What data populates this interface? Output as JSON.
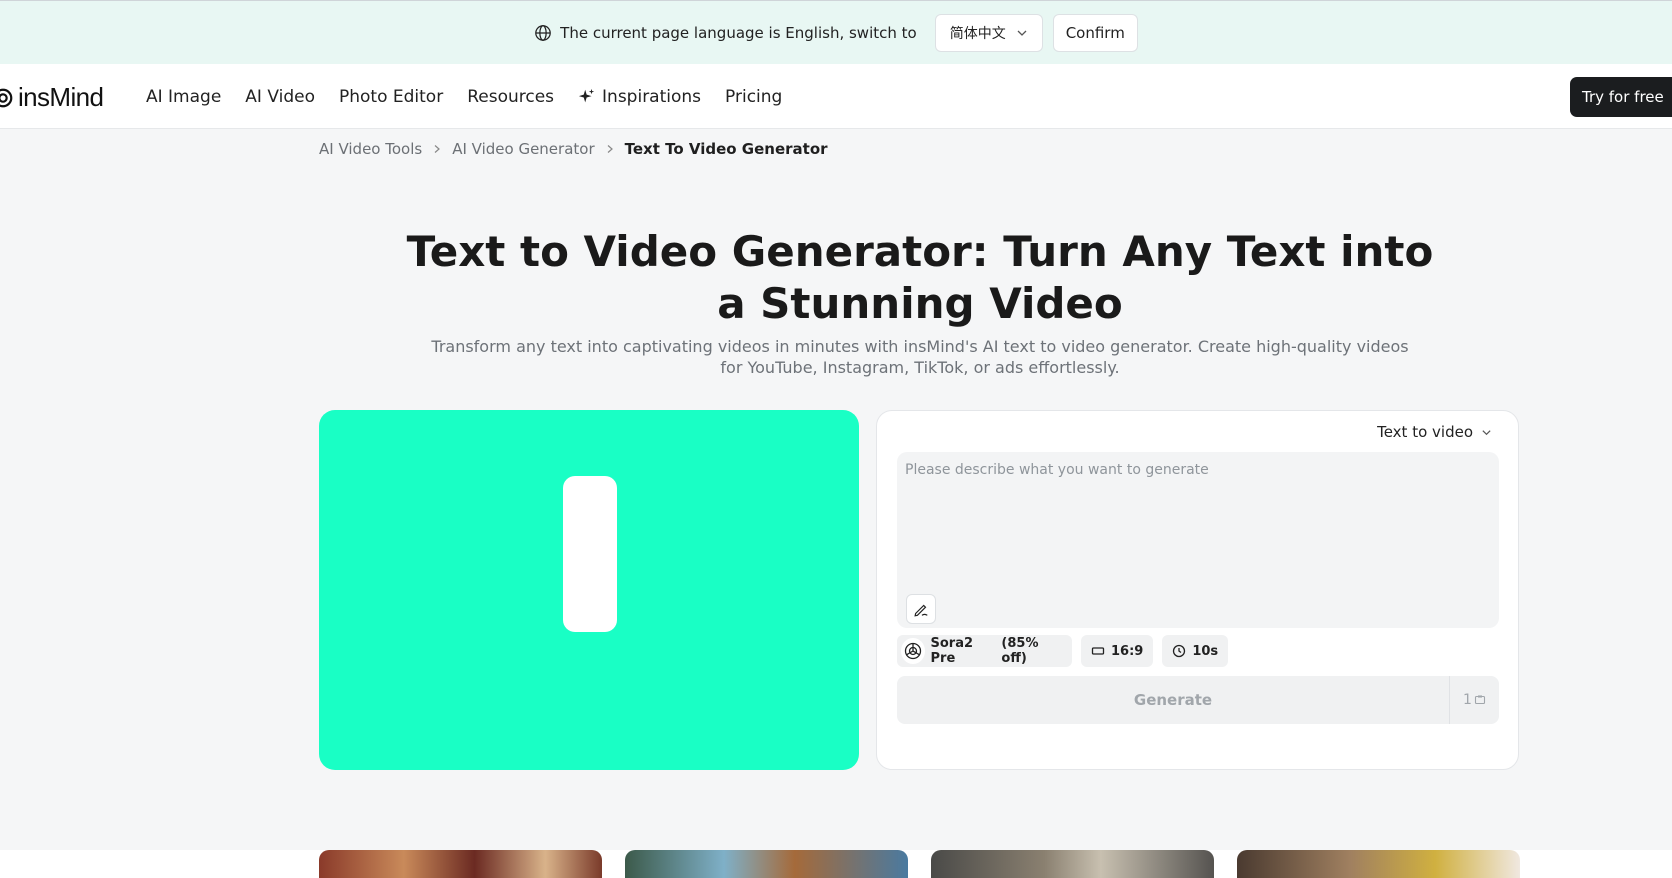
{
  "language_banner": {
    "message": "The current page language is English, switch to",
    "selected_language": "简体中文",
    "confirm_label": "Confirm"
  },
  "nav": {
    "logo_text": "insMind",
    "items": [
      "AI Image",
      "AI Video",
      "Photo Editor",
      "Resources",
      "Inspirations",
      "Pricing"
    ],
    "cta_label": "Try for free"
  },
  "breadcrumb": [
    "AI Video Tools",
    "AI Video Generator",
    "Text To Video Generator"
  ],
  "hero": {
    "title": "Text to Video Generator: Turn Any Text into a Stunning Video",
    "subtitle": "Transform any text into captivating videos in minutes with insMind's AI text to video generator. Create high-quality videos for YouTube, Instagram, TikTok, or ads effortlessly."
  },
  "generator": {
    "mode_label": "Text to video",
    "prompt_placeholder": "Please describe what you want to generate",
    "model_name": "Sora2 Pre",
    "model_discount": "(85% off)",
    "aspect_ratio": "16:9",
    "duration": "10s",
    "generate_label": "Generate",
    "credit_cost": "1"
  },
  "colors": {
    "preview_bg": "#19ffc5",
    "banner_bg": "#e8f7f3",
    "cta_bg": "#1b1d1f"
  },
  "icons": [
    "globe-icon",
    "chevron-down-icon",
    "sparkle-icon",
    "chevron-right-icon",
    "ai-write-icon",
    "openai-icon",
    "aspect-ratio-icon",
    "clock-icon",
    "credit-icon"
  ]
}
